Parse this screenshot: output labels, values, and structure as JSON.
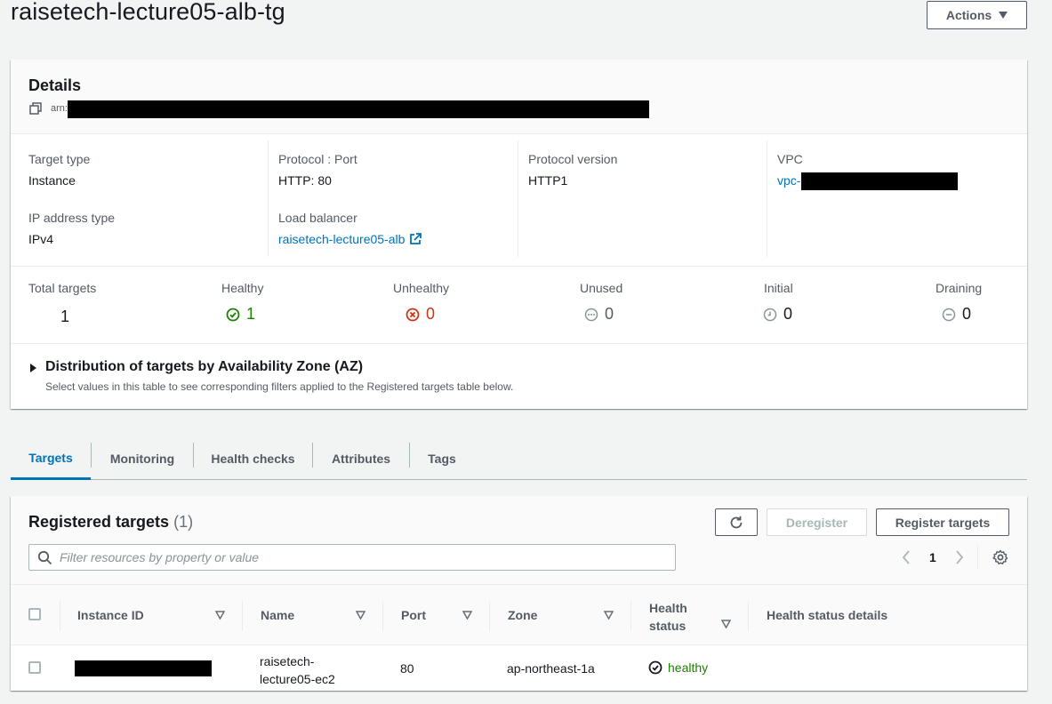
{
  "page": {
    "title": "raisetech-lecture05-alb-tg"
  },
  "header": {
    "actions_label": "Actions"
  },
  "details": {
    "title": "Details",
    "arn_label": "arn:",
    "fields": {
      "target_type_label": "Target type",
      "target_type_value": "Instance",
      "protocol_port_label": "Protocol : Port",
      "protocol_port_value": "HTTP: 80",
      "protocol_version_label": "Protocol version",
      "protocol_version_value": "HTTP1",
      "vpc_label": "VPC",
      "vpc_value": "vpc-",
      "ip_type_label": "IP address type",
      "ip_type_value": "IPv4",
      "lb_label": "Load balancer",
      "lb_value": "raisetech-lecture05-alb"
    },
    "counts": {
      "total_label": "Total targets",
      "total_value": "1",
      "healthy_label": "Healthy",
      "healthy_value": "1",
      "unhealthy_label": "Unhealthy",
      "unhealthy_value": "0",
      "unused_label": "Unused",
      "unused_value": "0",
      "initial_label": "Initial",
      "initial_value": "0",
      "draining_label": "Draining",
      "draining_value": "0"
    },
    "az": {
      "title": "Distribution of targets by Availability Zone (AZ)",
      "subtitle": "Select values in this table to see corresponding filters applied to the Registered targets table below."
    }
  },
  "tabs": [
    "Targets",
    "Monitoring",
    "Health checks",
    "Attributes",
    "Tags"
  ],
  "registered": {
    "title": "Registered targets",
    "count": "(1)",
    "deregister_label": "Deregister",
    "register_label": "Register targets",
    "search_placeholder": "Filter resources by property or value",
    "page": "1",
    "columns": {
      "instance_id": "Instance ID",
      "name": "Name",
      "port": "Port",
      "zone": "Zone",
      "health_status_line1": "Health",
      "health_status_line2": "status",
      "health_details": "Health status details"
    },
    "rows": [
      {
        "name_line1": "raisetech-",
        "name_line2": "lecture05-ec2",
        "port": "80",
        "zone": "ap-northeast-1a",
        "health": "healthy",
        "health_details": ""
      }
    ]
  },
  "colors": {
    "link": "#0073bb",
    "healthy": "#1d8102",
    "unhealthy": "#d13212",
    "neutral": "#879596"
  }
}
